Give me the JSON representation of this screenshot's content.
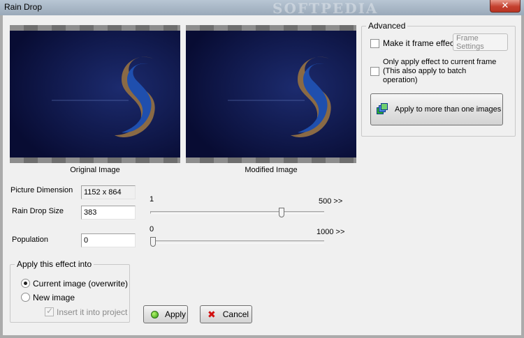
{
  "window": {
    "title": "Rain Drop",
    "watermark": "SOFTPEDIA",
    "close_glyph": "✕"
  },
  "preview": {
    "original_caption": "Original Image",
    "modified_caption": "Modified Image"
  },
  "settings": {
    "picture_dimension_label": "Picture Dimension",
    "picture_dimension_value": "1152 x 864",
    "rain_drop_size_label": "Rain Drop Size",
    "rain_drop_size_value": "383",
    "rain_drop_slider": {
      "min_label": "1",
      "max_label": "500 >>",
      "min": 1,
      "max": 500,
      "value": 383
    },
    "population_label": "Population",
    "population_value": "0",
    "population_slider": {
      "min_label": "0",
      "max_label": "1000 >>",
      "min": 0,
      "max": 1000,
      "value": 0
    }
  },
  "apply_into": {
    "title": "Apply this effect into",
    "options": [
      "Current image (overwrite)",
      "New image"
    ],
    "selected": 0,
    "insert_label": "Insert it into project"
  },
  "advanced": {
    "title": "Advanced",
    "frame_effect_label": "Make it frame effect",
    "frame_settings_button": "Frame Settings",
    "only_current_line1": "Only apply effect to current frame",
    "only_current_line2": "(This also apply to batch",
    "only_current_line3": "operation)",
    "apply_multiple_button": "Apply to more than one images"
  },
  "buttons": {
    "apply": "Apply",
    "cancel": "Cancel",
    "cancel_glyph": "✖"
  }
}
